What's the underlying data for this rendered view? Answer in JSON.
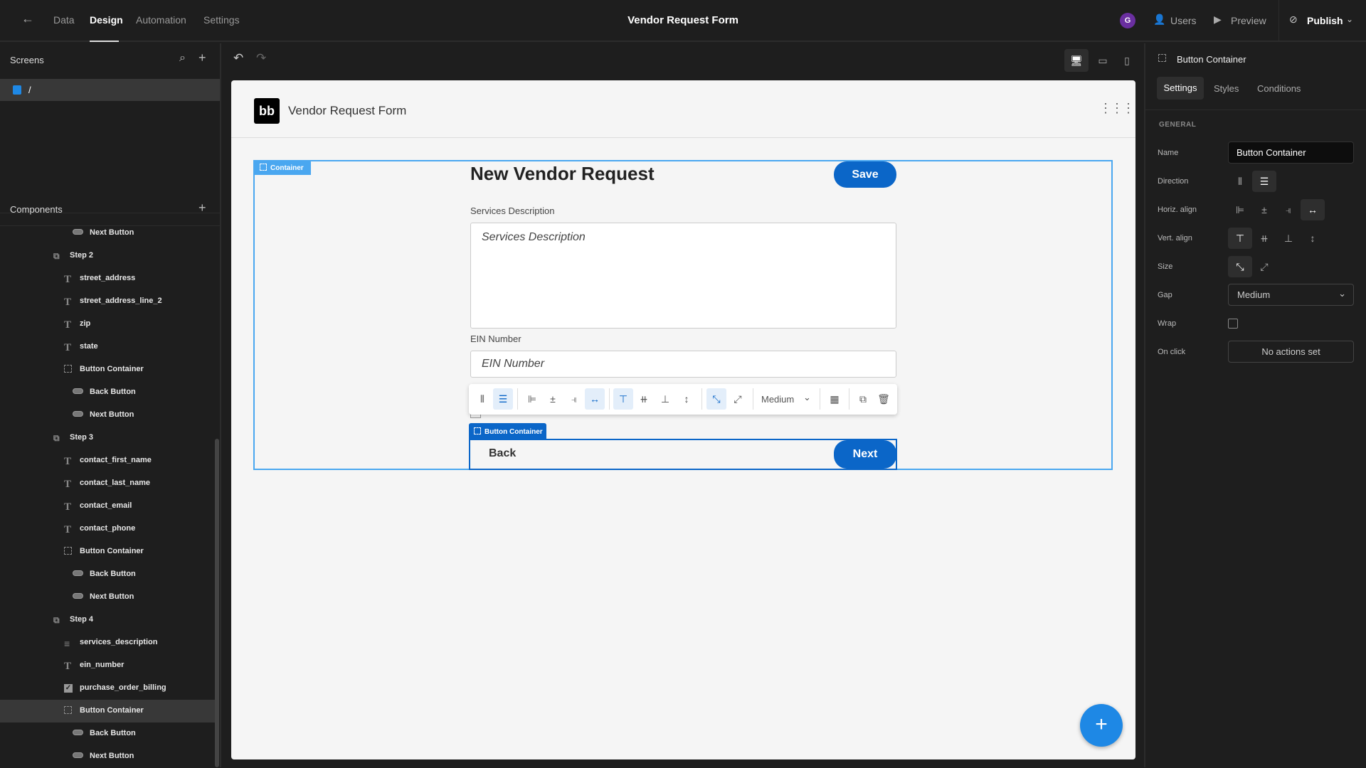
{
  "topbar": {
    "nav": [
      "Data",
      "Design",
      "Automation",
      "Settings"
    ],
    "active": "Design",
    "title": "Vendor Request Form",
    "avatar": "G",
    "users": "Users",
    "preview": "Preview",
    "publish": "Publish"
  },
  "screens": {
    "title": "Screens",
    "items": [
      "/"
    ]
  },
  "components": {
    "title": "Components",
    "items": [
      {
        "label": "Next Button",
        "type": "button",
        "level": 3
      },
      {
        "label": "Step 2",
        "type": "step",
        "level": 1
      },
      {
        "label": "street_address",
        "type": "text",
        "level": 2
      },
      {
        "label": "street_address_line_2",
        "type": "text",
        "level": 2
      },
      {
        "label": "zip",
        "type": "text",
        "level": 2
      },
      {
        "label": "state",
        "type": "text",
        "level": 2
      },
      {
        "label": "Button Container",
        "type": "container",
        "level": 2
      },
      {
        "label": "Back Button",
        "type": "button",
        "level": 3
      },
      {
        "label": "Next Button",
        "type": "button",
        "level": 3
      },
      {
        "label": "Step 3",
        "type": "step",
        "level": 1
      },
      {
        "label": "contact_first_name",
        "type": "text",
        "level": 2
      },
      {
        "label": "contact_last_name",
        "type": "text",
        "level": 2
      },
      {
        "label": "contact_email",
        "type": "text",
        "level": 2
      },
      {
        "label": "contact_phone",
        "type": "text",
        "level": 2
      },
      {
        "label": "Button Container",
        "type": "container",
        "level": 2
      },
      {
        "label": "Back Button",
        "type": "button",
        "level": 3
      },
      {
        "label": "Next Button",
        "type": "button",
        "level": 3
      },
      {
        "label": "Step 4",
        "type": "step",
        "level": 1
      },
      {
        "label": "services_description",
        "type": "longform",
        "level": 2
      },
      {
        "label": "ein_number",
        "type": "text",
        "level": 2
      },
      {
        "label": "purchase_order_billing",
        "type": "checkbox",
        "level": 2
      },
      {
        "label": "Button Container",
        "type": "container",
        "level": 2,
        "selected": true
      },
      {
        "label": "Back Button",
        "type": "button",
        "level": 3
      },
      {
        "label": "Next Button",
        "type": "button",
        "level": 3
      }
    ]
  },
  "canvas": {
    "app_title": "Vendor Request Form",
    "container_tag": "Container",
    "form_title": "New Vendor Request",
    "save": "Save",
    "services_label": "Services Description",
    "services_placeholder": "Services Description",
    "ein_label": "EIN Number",
    "ein_placeholder": "EIN Number",
    "toolbar_gap": "Medium",
    "button_container_tag": "Button Container",
    "back": "Back",
    "next": "Next",
    "add": "+"
  },
  "props": {
    "title": "Button Container",
    "tabs": [
      "Settings",
      "Styles",
      "Conditions"
    ],
    "active_tab": "Settings",
    "section": "GENERAL",
    "name_label": "Name",
    "name_value": "Button Container",
    "direction_label": "Direction",
    "halign_label": "Horiz. align",
    "valign_label": "Vert. align",
    "size_label": "Size",
    "gap_label": "Gap",
    "gap_value": "Medium",
    "wrap_label": "Wrap",
    "wrap_checked": false,
    "onclick_label": "On click",
    "onclick_value": "No actions set"
  },
  "colors": {
    "accent": "#0b66c8",
    "selection": "#4aa7f0",
    "avatar": "#6a2fa0"
  }
}
